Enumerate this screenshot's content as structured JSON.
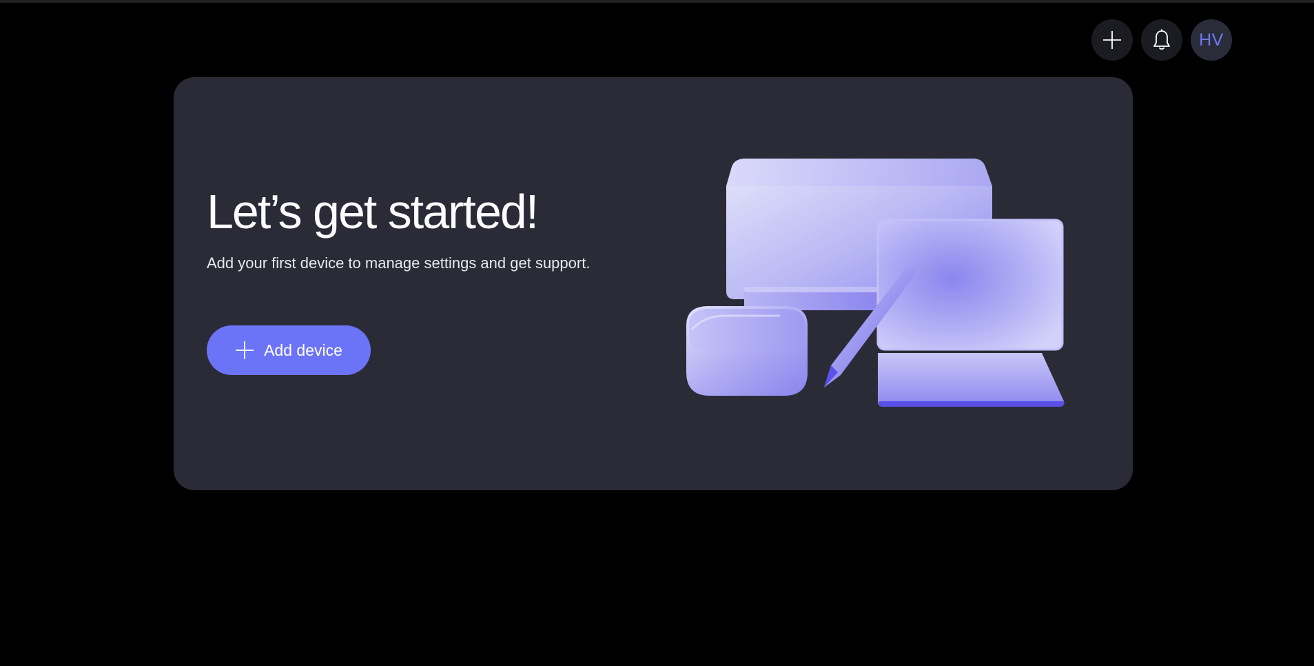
{
  "header": {
    "add_icon": "plus-icon",
    "notifications_icon": "bell-icon",
    "avatar_initials": "HV"
  },
  "hero": {
    "title": "Let’s get started!",
    "subtitle": "Add your first device to manage settings and get support.",
    "button_label": "Add device",
    "button_icon": "plus-icon"
  },
  "illustration": {
    "icon": "devices-illustration"
  },
  "colors": {
    "background": "#000000",
    "card": "#2b2b37",
    "accent": "#6b74f6",
    "avatar_text": "#6f78f5",
    "icon_button": "#1b1c22"
  }
}
